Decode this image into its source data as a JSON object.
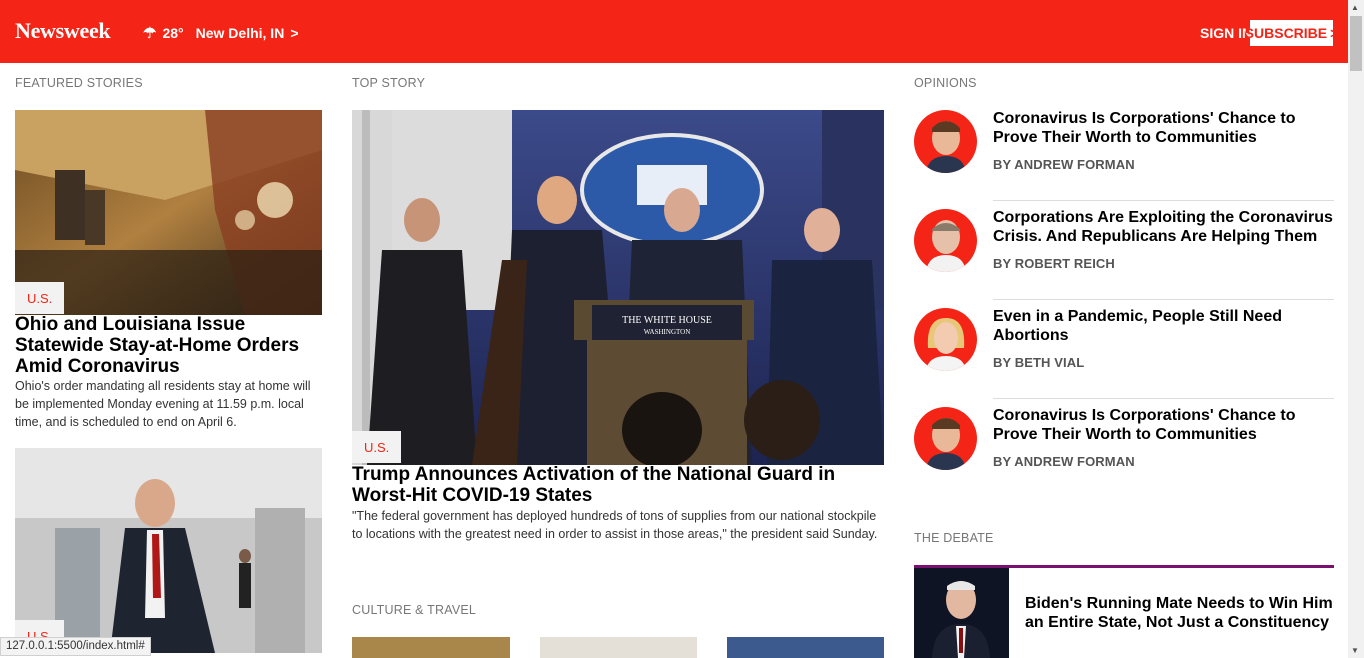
{
  "header": {
    "logo": "Newsweek",
    "temperature": "28°",
    "location": "New Delhi, IN",
    "sign_in": "SIGN IN",
    "subscribe": "SUBSCRIBE"
  },
  "featured": {
    "label": "FEATURED STORIES",
    "stories": [
      {
        "category": "U.S.",
        "title": "Ohio and Louisiana Issue Statewide Stay-at-Home Orders Amid Coronavirus",
        "description": "Ohio's order mandating all residents stay at home will be implemented Monday evening at 11.59 p.m. local time, and is scheduled to end on April 6."
      },
      {
        "category": "U.S."
      }
    ]
  },
  "top_story": {
    "label": "TOP STORY",
    "category": "U.S.",
    "title": "Trump Announces Activation of the National Guard in Worst-Hit COVID-19 States",
    "description": "\"The federal government has deployed hundreds of tons of supplies from our national stockpile to locations with the greatest need in order to assist in those areas,\" the president said Sunday.",
    "podium_text_1": "THE WHITE HOUSE",
    "podium_text_2": "WASHINGTON"
  },
  "culture": {
    "label": "CULTURE & TRAVEL"
  },
  "opinions": {
    "label": "OPINIONS",
    "items": [
      {
        "title": "Coronavirus Is Corporations' Chance to Prove Their Worth to Communities",
        "author": "BY ANDREW FORMAN"
      },
      {
        "title": "Corporations Are Exploiting the Coronavirus Crisis. And Republicans Are Helping Them",
        "author": "BY ROBERT REICH"
      },
      {
        "title": "Even in a Pandemic, People Still Need Abortions",
        "author": "BY BETH VIAL"
      },
      {
        "title": "Coronavirus Is Corporations' Chance to Prove Their Worth to Communities",
        "author": "BY ANDREW FORMAN"
      }
    ]
  },
  "debate": {
    "label": "THE DEBATE",
    "title": "Biden's Running Mate Needs to Win Him an Entire State, Not Just a Constituency"
  },
  "status_bar": {
    "url": "127.0.0.1:5500/index.html#"
  },
  "colors": {
    "brand_red": "#f42416",
    "debate_purple": "#7a1070"
  },
  "icons": {
    "weather": "cloud-rain-icon",
    "subscribe_arrow": "chevron-right-icon"
  }
}
